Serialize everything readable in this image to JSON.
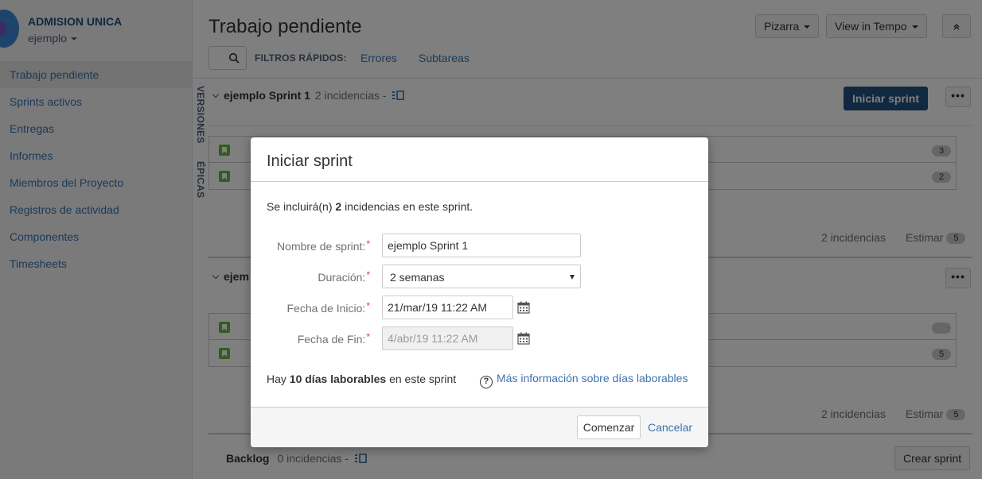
{
  "project": {
    "name": "ADMISION UNICA",
    "subtitle": "ejemplo"
  },
  "sidebar": {
    "items": [
      {
        "label": "Trabajo pendiente"
      },
      {
        "label": "Sprints activos"
      },
      {
        "label": "Entregas"
      },
      {
        "label": "Informes"
      },
      {
        "label": "Miembros del Proyecto"
      },
      {
        "label": "Registros de actividad"
      },
      {
        "label": "Componentes"
      },
      {
        "label": "Timesheets"
      }
    ]
  },
  "header": {
    "title": "Trabajo pendiente",
    "board_button": "Pizarra",
    "tempo_button": "View in Tempo",
    "quick_filters_label": "FILTROS RÁPIDOS:",
    "filters": [
      "Errores",
      "Subtareas"
    ]
  },
  "side_tabs": {
    "versions": "VERSIONES",
    "epics": "ÉPICAS"
  },
  "sprint1": {
    "title": "ejemplo Sprint 1",
    "count": "2 incidencias -",
    "start_button": "Iniciar sprint",
    "more_label": "•••",
    "issues": [
      {
        "estimate": "3"
      },
      {
        "estimate": "2"
      }
    ],
    "footer_count": "2 incidencias",
    "footer_estimate_label": "Estimar",
    "footer_estimate": "5"
  },
  "sprint2": {
    "title_partial": "ejem",
    "more_label": "•••",
    "issues": [
      {
        "estimate": ""
      },
      {
        "estimate": "5"
      }
    ],
    "footer_count": "2 incidencias",
    "footer_estimate_label": "Estimar",
    "footer_estimate": "5"
  },
  "backlog": {
    "title": "Backlog",
    "count": "0 incidencias -",
    "create_button": "Crear sprint"
  },
  "dialog": {
    "title": "Iniciar sprint",
    "intro_prefix": "Se incluirá(n)",
    "intro_count": "2",
    "intro_suffix": "incidencias en este sprint.",
    "name_label": "Nombre de sprint:",
    "name_value": "ejemplo Sprint 1",
    "duration_label": "Duración:",
    "duration_value": "2 semanas",
    "start_label": "Fecha de Inicio:",
    "start_value": "21/mar/19 11:22 AM",
    "end_label": "Fecha de Fin:",
    "end_value": "4/abr/19 11:22 AM",
    "required_mark": "*",
    "work_prefix": "Hay",
    "work_days": "10 días laborables",
    "work_suffix": "en este sprint",
    "help_link": "Más información sobre días laborables",
    "ok_button": "Comenzar",
    "cancel_link": "Cancelar"
  }
}
